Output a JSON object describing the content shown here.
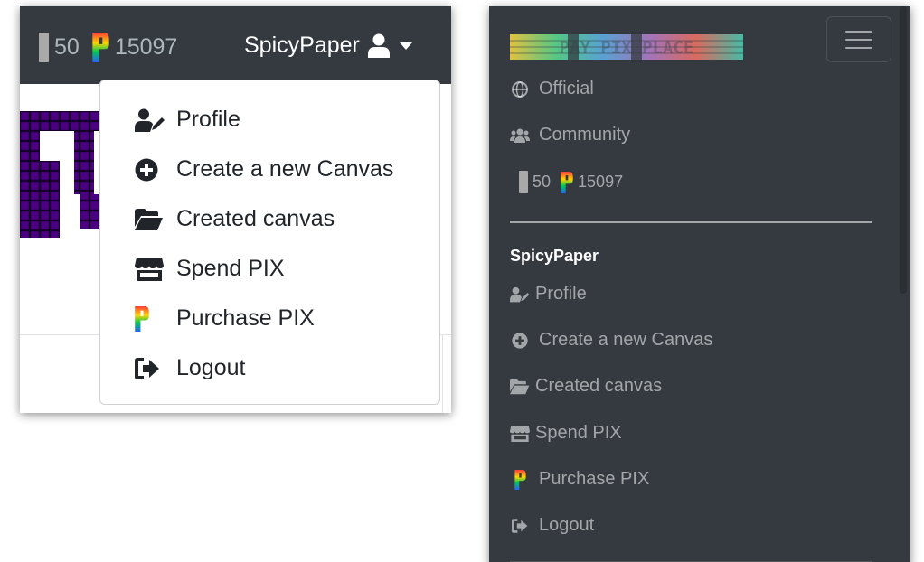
{
  "topbar": {
    "pix_count": "50",
    "pix_balance": "15097",
    "username": "SpicyPaper"
  },
  "dropdown": {
    "items": [
      {
        "label": "Profile",
        "icon": "user-edit-icon"
      },
      {
        "label": "Create a new Canvas",
        "icon": "plus-circle-icon"
      },
      {
        "label": "Created canvas",
        "icon": "folder-open-icon"
      },
      {
        "label": "Spend PIX",
        "icon": "store-icon"
      },
      {
        "label": "Purchase PIX",
        "icon": "pix-logo-icon"
      },
      {
        "label": "Logout",
        "icon": "sign-out-icon"
      }
    ]
  },
  "mobile_menu": {
    "brand_name": "PAY PIX PLACE",
    "nav": [
      {
        "label": "Official",
        "icon": "globe-icon"
      },
      {
        "label": "Community",
        "icon": "users-icon"
      }
    ],
    "pix_count": "50",
    "pix_balance": "15097",
    "username": "SpicyPaper",
    "items": [
      {
        "label": "Profile",
        "icon": "user-edit-icon"
      },
      {
        "label": "Create a new Canvas",
        "icon": "plus-circle-icon"
      },
      {
        "label": "Created canvas",
        "icon": "folder-open-icon"
      },
      {
        "label": "Spend PIX",
        "icon": "store-icon"
      },
      {
        "label": "Purchase PIX",
        "icon": "pix-logo-icon"
      },
      {
        "label": "Logout",
        "icon": "sign-out-icon"
      }
    ]
  },
  "colors": {
    "navbar_bg": "#343a40",
    "canvas_pixel": "#4b0082",
    "text_muted": "#adb5bd"
  }
}
